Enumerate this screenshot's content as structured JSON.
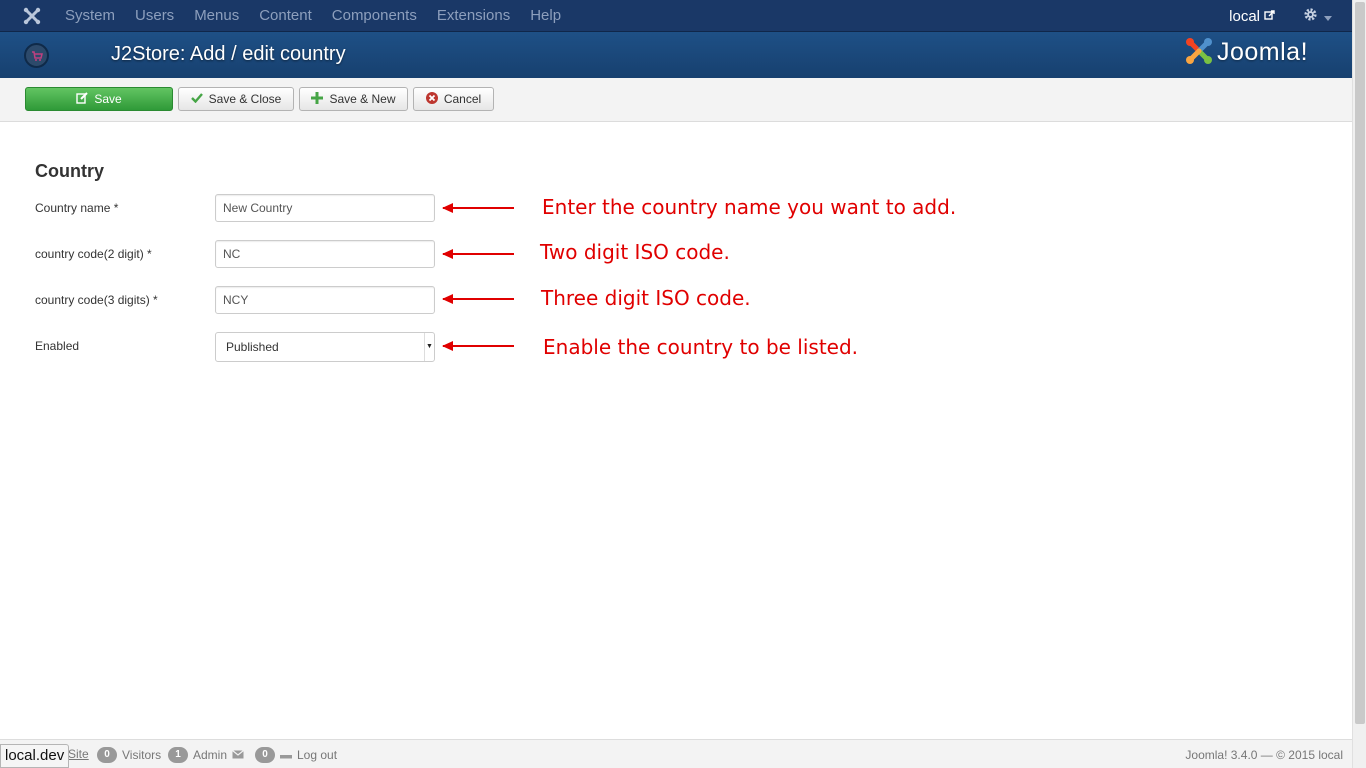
{
  "nav": {
    "menu": [
      "System",
      "Users",
      "Menus",
      "Content",
      "Components",
      "Extensions",
      "Help"
    ],
    "user": "local"
  },
  "header": {
    "title": "J2Store: Add / edit country",
    "brand": "Joomla!"
  },
  "toolbar": {
    "save": "Save",
    "save_close": "Save & Close",
    "save_new": "Save & New",
    "cancel": "Cancel"
  },
  "form": {
    "section_title": "Country",
    "fields": [
      {
        "label": "Country name *",
        "value": "New Country"
      },
      {
        "label": "country code(2 digit) *",
        "value": "NC"
      },
      {
        "label": "country code(3 digits) *",
        "value": "NCY"
      },
      {
        "label": "Enabled",
        "value": "Published"
      }
    ]
  },
  "annotations": [
    "Enter the country name you want to add.",
    "Two digit ISO code.",
    "Three digit ISO code.",
    "Enable the country to be listed."
  ],
  "annotation_color": "#e00000",
  "status": {
    "site": "Site",
    "visitors_count": "0",
    "visitors": "Visitors",
    "admin_count": "1",
    "admin": "Admin",
    "messages_count": "0",
    "logout": "Log out",
    "footer": "Joomla! 3.4.0 — © 2015 local",
    "url_tip": "local.dev"
  },
  "colors": {
    "navbar": "#1a3867",
    "header": "#1b4a7f",
    "save_button": "#3fae49"
  }
}
